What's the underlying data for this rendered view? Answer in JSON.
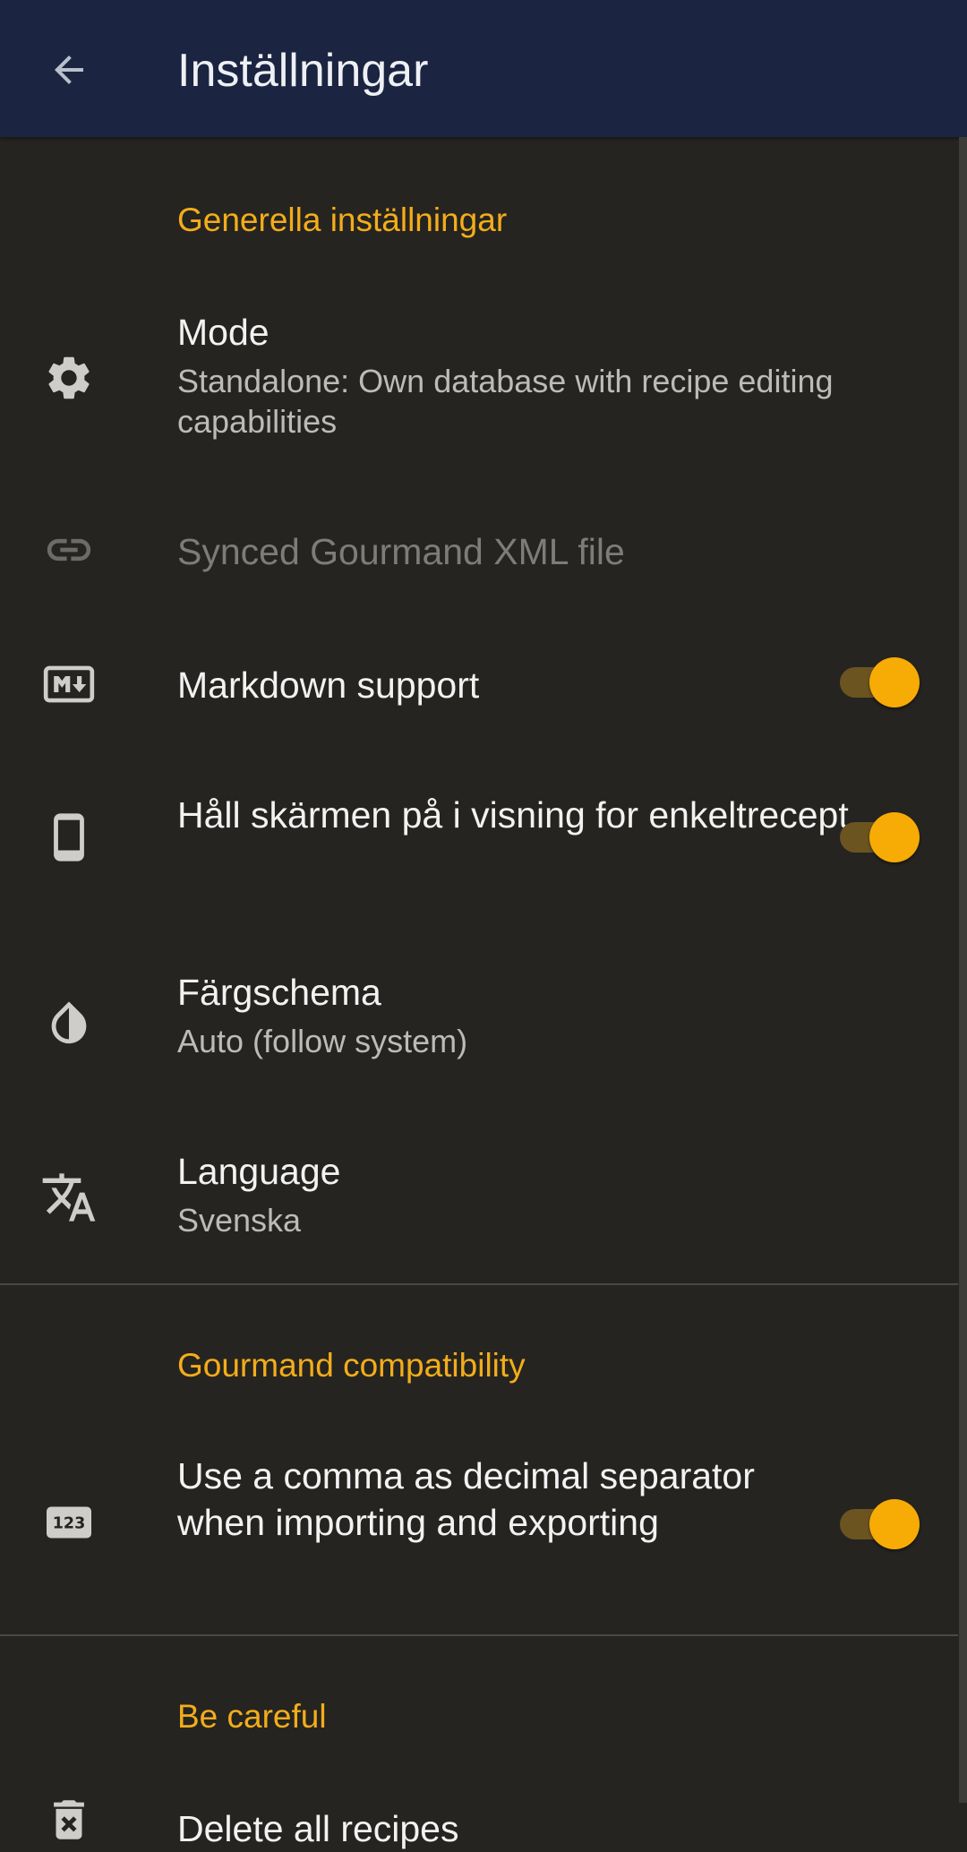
{
  "appbar": {
    "title": "Inställningar",
    "back_icon": "arrow-back-icon"
  },
  "colors": {
    "accent": "#f3ad1a",
    "toolbar": "#1b2440",
    "background": "#252421"
  },
  "sections": {
    "general": {
      "header": "Generella inställningar",
      "mode": {
        "title": "Mode",
        "summary": "Standalone: Own database with recipe editing capabilities",
        "icon": "gear-icon"
      },
      "synced_file": {
        "title": "Synced Gourmand XML file",
        "icon": "link-icon",
        "enabled": false
      },
      "markdown": {
        "title": "Markdown support",
        "icon": "markdown-icon",
        "checked": true
      },
      "keep_screen_on": {
        "title": "Håll skärmen på i visning for enkeltrecept",
        "icon": "phone-icon",
        "checked": true
      },
      "color_scheme": {
        "title": "Färgschema",
        "summary": "Auto (follow system)",
        "icon": "contrast-icon"
      },
      "language": {
        "title": "Language",
        "summary": "Svenska",
        "icon": "translate-icon"
      }
    },
    "gourmand": {
      "header": "Gourmand compatibility",
      "comma": {
        "title": "Use a comma as decimal separator when importing and exporting",
        "icon": "numbers-icon",
        "checked": true
      }
    },
    "careful": {
      "header": "Be careful",
      "delete": {
        "title": "Delete all recipes",
        "icon": "delete-icon"
      }
    }
  }
}
